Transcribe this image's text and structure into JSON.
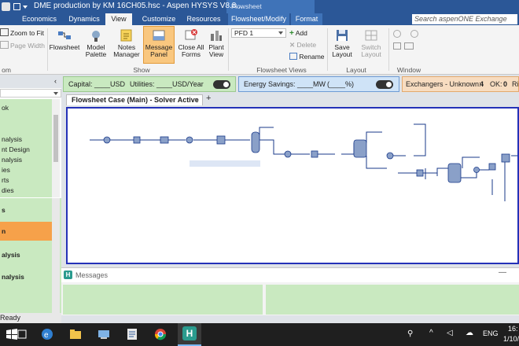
{
  "window": {
    "title": "DME production by KM 16CH05.hsc - Aspen HYSYS V8.8...",
    "context_tab": "Flowsheet"
  },
  "tabs": [
    "Economics",
    "Dynamics",
    "View",
    "Customize",
    "Resources",
    "Flowsheet/Modify",
    "Format"
  ],
  "search": {
    "placeholder": "Search aspenONE Exchange"
  },
  "ribbon": {
    "zoom_to_fit": "Zoom to Fit",
    "page_width": "Page Width",
    "zoom_group": "om",
    "flowsheet": "Flowsheet",
    "model_palette_1": "Model",
    "model_palette_2": "Palette",
    "notes_manager_1": "Notes",
    "notes_manager_2": "Manager",
    "message_panel_1": "Message",
    "message_panel_2": "Panel",
    "close_all_1": "Close All",
    "close_all_2": "Forms",
    "plant_view_1": "Plant",
    "plant_view_2": "View",
    "show_group": "Show",
    "pfd_select": "PFD 1",
    "add": "Add",
    "delete": "Delete",
    "rename": "Rename",
    "flowsheet_views_group": "Flowsheet Views",
    "save_layout_1": "Save",
    "save_layout_2": "Layout",
    "switch_layout_1": "Switch",
    "switch_layout_2": "Layout",
    "layout_group": "Layout",
    "window_group": "Window"
  },
  "nav": {
    "items": [
      "ok",
      "",
      "nalysis",
      "nt Design",
      "nalysis",
      "ies",
      "rts",
      "dies"
    ],
    "sections": [
      "s",
      "n",
      "alysis",
      "nalysis"
    ]
  },
  "econ_bar": {
    "capital": "Capital: ____USD",
    "utilities": "Utilities: ____USD/Year",
    "energy": "Energy Savings: ____MW",
    "energy_pct": "(____%)",
    "exchangers": "Exchangers - Unknown:",
    "exchangers_count": "4",
    "ok_label": "OK:",
    "ok_count": "0",
    "ri": "Ri"
  },
  "doc_tab": {
    "label": "Flowsheet Case (Main) - Solver Active",
    "close": "×",
    "add": "+"
  },
  "messages": {
    "title": "Messages"
  },
  "status": {
    "ready": "Ready"
  },
  "taskbar": {
    "language": "ENG",
    "time": "16:",
    "date": "1/10/"
  },
  "colors": {
    "title_blue": "#2b5797",
    "green_panel": "#c9e9c0",
    "blue_panel": "#cfe3f7",
    "orange_panel": "#f7dcc0",
    "active_nav": "#f6a14a",
    "canvas_border": "#2431b8"
  }
}
